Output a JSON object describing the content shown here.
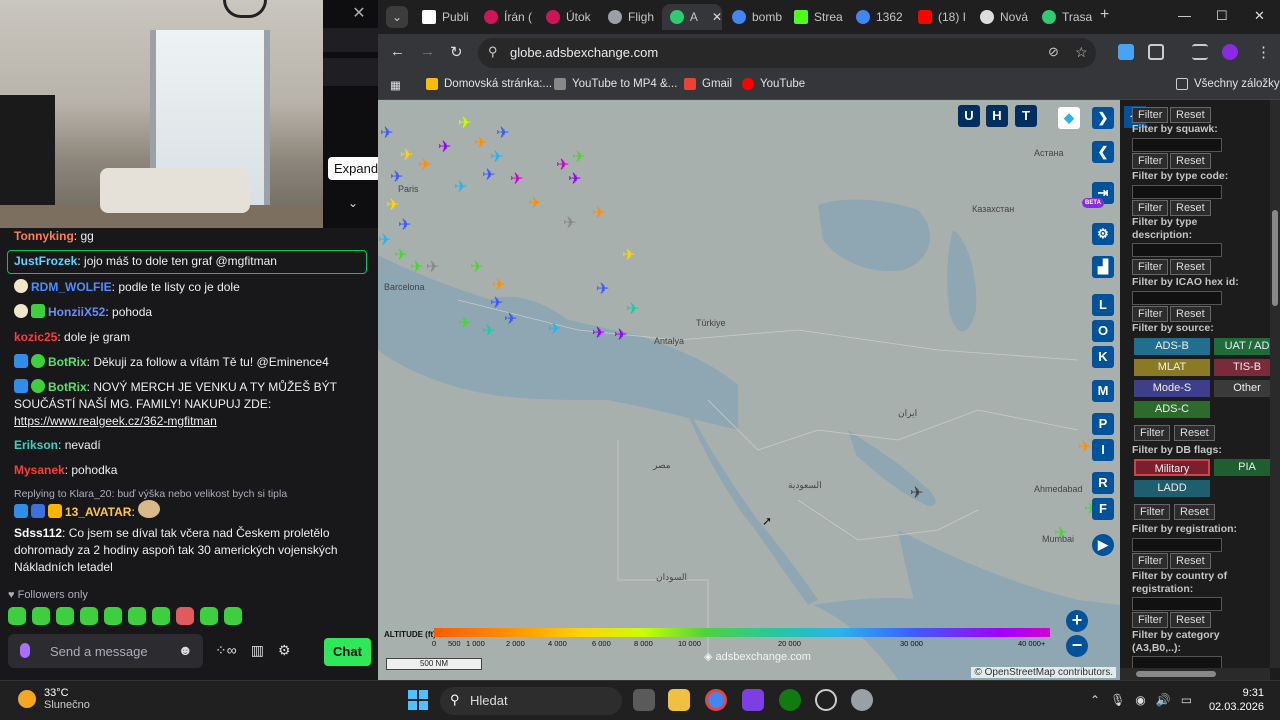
{
  "chat": {
    "expand_tooltip": "Expand",
    "messages": [
      {
        "user": "Tonnyking",
        "user_color": "#ff7f50",
        "text": "gg"
      },
      {
        "user": "JustFrozek",
        "user_color": "#5cd6ff",
        "text": "jojo máš to dole ten graf @mgfitman"
      },
      {
        "user": "RDM_WOLFIE",
        "user_color": "#4f8cff",
        "text": "podle te listy co je dole"
      },
      {
        "user": "HonziiX52",
        "user_color": "#6a8cff",
        "text": "pohoda"
      },
      {
        "user": "kozic25",
        "user_color": "#ff3b3b",
        "text": "dole je gram"
      },
      {
        "user": "BotRix",
        "user_color": "#54e26d",
        "text": "Děkuji za follow a vítám Tě tu! @Eminence4"
      },
      {
        "user": "BotRix",
        "user_color": "#54e26d",
        "text": "NOVÝ MERCH JE VENKU A TY MŮŽEŠ BÝT SOUČÁSTÍ NAŠÍ MG. FAMILY! NAKUPUJ ZDE:",
        "link": "https://www.realgeek.cz/362-mgfitman"
      },
      {
        "user": "Erikson",
        "user_color": "#3fd0c4",
        "text": "nevadí"
      },
      {
        "user": "Mysanek",
        "user_color": "#ff3b3b",
        "text": "pohodka"
      },
      {
        "user": "13_AVATAR",
        "user_color": "#ffc83d",
        "text": ""
      },
      {
        "user": "Sdss112",
        "user_color": "#ffffff",
        "text": "Co jsem se díval tak včera nad Českem proletělo dohromady za 2 hodiny aspoň tak 30 amerických vojenských Nákladních letadel"
      }
    ],
    "reply_note": "Replying to Klara_20: buď výška nebo velikost bych si tipla",
    "followers_only": "Followers only",
    "send_placeholder": "Send a message",
    "chat_button": "Chat"
  },
  "browser": {
    "tabs": [
      {
        "label": "Publi",
        "color": "#ffffff"
      },
      {
        "label": "Írán (",
        "color": "#d0145a"
      },
      {
        "label": "Útok",
        "color": "#d0145a"
      },
      {
        "label": "Fligh",
        "color": "#9aa0a6"
      },
      {
        "label": "A",
        "color": "#2ecc71",
        "active": true
      },
      {
        "label": "bomb",
        "color": "#4285f4"
      },
      {
        "label": "Strea",
        "color": "#53fc18"
      },
      {
        "label": "1362",
        "color": "#4285f4"
      },
      {
        "label": "(18) I",
        "color": "#ff0000"
      },
      {
        "label": "Nová",
        "color": "#ffffff"
      },
      {
        "label": "Trasa",
        "color": "#2ecc71"
      }
    ],
    "url": "globe.adsbexchange.com",
    "bookmarks": [
      {
        "label": "Domovská stránka:...",
        "color": "#fbbc05"
      },
      {
        "label": "YouTube to MP4 &...",
        "color": "#888888"
      },
      {
        "label": "Gmail",
        "color": "#ea4335"
      },
      {
        "label": "YouTube",
        "color": "#ff0000"
      }
    ],
    "all_bookmarks": "Všechny záložky"
  },
  "map": {
    "top_buttons": [
      "U",
      "H",
      "T"
    ],
    "side_buttons": [
      "L",
      "O",
      "K",
      "M",
      "P",
      "I",
      "R",
      "F"
    ],
    "beta": "BETA",
    "altitude_label": "ALTITUDE (ft)",
    "altitude_ticks": [
      "0",
      "500",
      "1 000",
      "2 000",
      "4 000",
      "6 000",
      "8 000",
      "10 000",
      "20 000",
      "30 000",
      "40 000+"
    ],
    "scale": "500 NM",
    "watermark": "adsbexchange.com",
    "attribution": "© OpenStreetMap contributors.",
    "places": [
      {
        "name": "Paris"
      },
      {
        "name": "Barcelona"
      },
      {
        "name": "Antalya"
      },
      {
        "name": "Türkiye"
      },
      {
        "name": "Казахстан"
      },
      {
        "name": "Астана"
      },
      {
        "name": "Ahmedabad"
      },
      {
        "name": "Mumbai"
      },
      {
        "name": "السعودية"
      },
      {
        "name": "مصر"
      },
      {
        "name": "السودان"
      },
      {
        "name": "ایران"
      }
    ]
  },
  "panel": {
    "filter": "Filter",
    "reset": "Reset",
    "labels": {
      "squawk": "Filter by squawk:",
      "type_code": "Filter by type code:",
      "type_desc": "Filter by type description:",
      "icao": "Filter by ICAO hex id:",
      "source": "Filter by source:",
      "db_flags": "Filter by DB flags:",
      "registration": "Filter by registration:",
      "country": "Filter by country of registration:",
      "category": "Filter by category (A3,B0,..):"
    },
    "sources": [
      "ADS-B",
      "UAT / AD",
      "MLAT",
      "TIS-B",
      "Mode-S",
      "Other",
      "ADS-C"
    ],
    "db_flags": [
      "Military",
      "PIA",
      "LADD"
    ]
  },
  "taskbar": {
    "temperature": "33°C",
    "weather": "Slunečno",
    "search": "Hledat",
    "time": "9:31",
    "date": "02.03.2026"
  }
}
